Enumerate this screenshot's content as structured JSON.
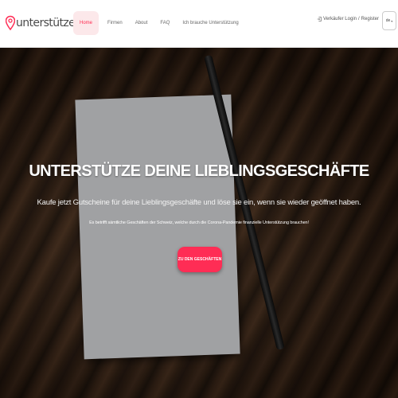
{
  "brand": {
    "name": "unterstütze.ch",
    "accent": "#ff2d55"
  },
  "nav": {
    "items": [
      {
        "label": "Home",
        "active": true
      },
      {
        "label": "Firmen",
        "active": false
      },
      {
        "label": "About",
        "active": false
      },
      {
        "label": "FAQ",
        "active": false
      },
      {
        "label": "Ich brauche Unterstützung",
        "active": false
      }
    ],
    "login_label": "Verkäufer Login",
    "separator": "/",
    "register_label": "Register",
    "language": "de"
  },
  "hero": {
    "title": "UNTERSTÜTZE DEINE LIEBLINGSGESCHÄFTE",
    "subtitle": "Kaufe jetzt Gutscheine für deine Lieblingsgeschäfte und löse sie ein, wenn sie wieder geöffnet haben.",
    "small_text": "Es betrifft sämtliche Geschäften der Schweiz, welche durch die Corona-Pandemie finanzielle Unterstützung brauchen!",
    "cta_label": "ZU DEN GESCHÄFTEN"
  }
}
